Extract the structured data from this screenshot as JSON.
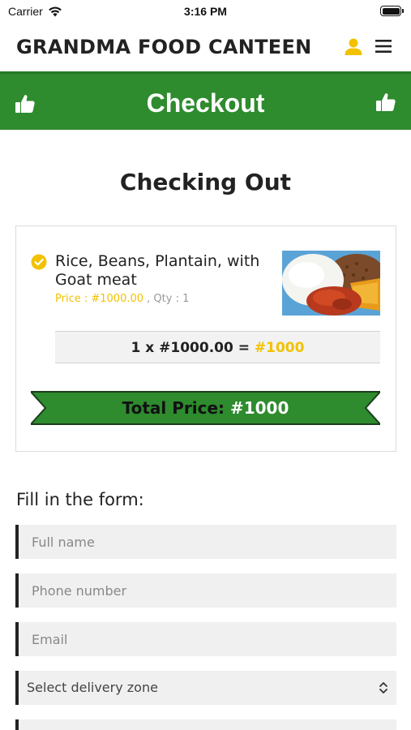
{
  "status_bar": {
    "carrier": "Carrier",
    "time": "3:16 PM"
  },
  "header": {
    "brand": "GRANDMA FOOD CANTEEN",
    "accent_color": "#f2c200"
  },
  "checkout_bar": {
    "title": "Checkout",
    "color": "#2e8b2e"
  },
  "page": {
    "section_title": "Checking Out"
  },
  "order": {
    "item_name": "Rice, Beans, Plantain, with Goat meat",
    "price_label": "Price : #1000.00",
    "qty_label": ", Qty : 1",
    "calc_expression": "1 x #1000.00 = ",
    "calc_total": "#1000",
    "total_label": "Total Price: ",
    "total_amount": "#1000"
  },
  "form": {
    "label": "Fill in the form:",
    "full_name_placeholder": "Full name",
    "phone_placeholder": "Phone number",
    "email_placeholder": "Email",
    "delivery_zone_selected": "Select delivery zone"
  },
  "icons": {
    "user": "user-icon",
    "menu": "menu-icon",
    "thumbs_up": "thumbs-up-icon",
    "check": "check-circle-icon",
    "select_arrows": "select-arrows-icon"
  }
}
